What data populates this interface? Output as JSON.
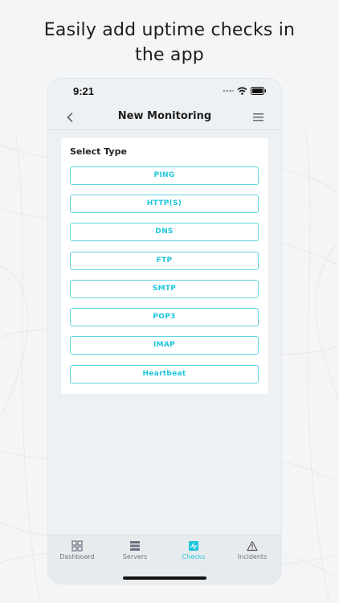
{
  "headline": {
    "line1": "Easily add uptime checks in",
    "line2": "the app"
  },
  "status_bar": {
    "time": "9:21"
  },
  "navbar": {
    "title": "New Monitoring"
  },
  "card": {
    "title": "Select Type",
    "types": [
      "PING",
      "HTTP(S)",
      "DNS",
      "FTP",
      "SMTP",
      "POP3",
      "IMAP",
      "Heartbeat"
    ]
  },
  "tabbar": {
    "active": "Checks",
    "tabs": [
      {
        "label": "Dashboard",
        "icon": "dashboard-grid-icon"
      },
      {
        "label": "Servers",
        "icon": "servers-stack-icon"
      },
      {
        "label": "Checks",
        "icon": "checks-pulse-icon"
      },
      {
        "label": "Incidents",
        "icon": "warning-triangle-icon"
      }
    ]
  },
  "colors": {
    "accent": "#1ec7dc",
    "border_accent": "#5fd4e2",
    "background": "#f4f5f6",
    "phone_bg": "#eef1f4"
  }
}
